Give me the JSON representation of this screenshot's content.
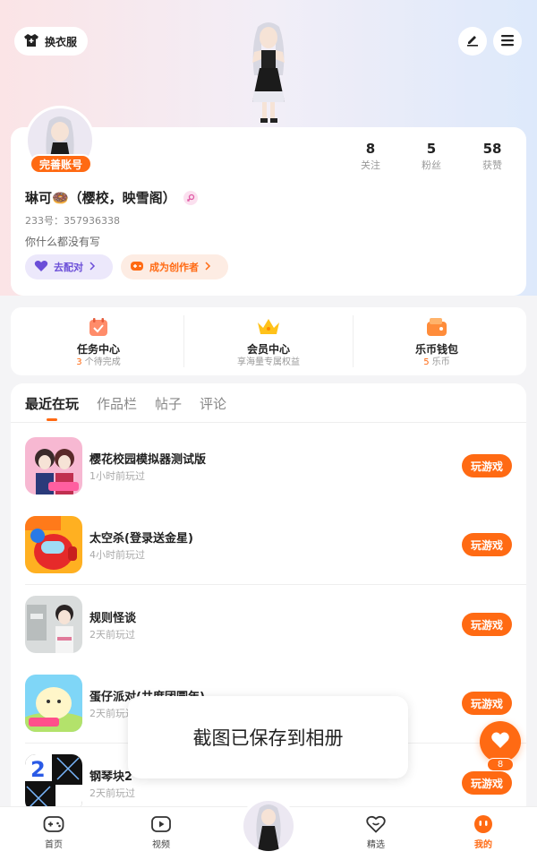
{
  "top": {
    "outfit_label": "换衣服"
  },
  "profile": {
    "badge": "完善账号",
    "stats": [
      {
        "value": "8",
        "label": "关注"
      },
      {
        "value": "5",
        "label": "粉丝"
      },
      {
        "value": "58",
        "label": "获赞"
      }
    ],
    "name": "琳可🍩（樱校，映雪阁）",
    "uid": "233号：357936338",
    "bio": "你什么都没有写",
    "pair_label": "去配对",
    "creator_label": "成为创作者"
  },
  "quick": [
    {
      "title": "任务中心",
      "count": "3",
      "sub": "个待完成"
    },
    {
      "title": "会员中心",
      "count": "",
      "sub": "享海量专属权益"
    },
    {
      "title": "乐币钱包",
      "count": "5",
      "sub": "乐币"
    }
  ],
  "tabs": [
    "最近在玩",
    "作品栏",
    "帖子",
    "评论"
  ],
  "games": [
    {
      "name": "樱花校园模拟器测试版",
      "time": "1小时前玩过",
      "button": "玩游戏"
    },
    {
      "name": "太空杀(登录送金星)",
      "time": "4小时前玩过",
      "button": "玩游戏"
    },
    {
      "name": "规则怪谈",
      "time": "2天前玩过",
      "button": "玩游戏"
    },
    {
      "name": "蛋仔派对(共度团圆年)",
      "time": "2天前玩过",
      "button": "玩游戏"
    },
    {
      "name": "钢琴块2",
      "time": "2天前玩过",
      "button": "玩游戏"
    }
  ],
  "toast": "截图已保存到相册",
  "float_count": "8",
  "nav": [
    {
      "label": "首页"
    },
    {
      "label": "视频"
    },
    {
      "label": "精选"
    },
    {
      "label": "我的"
    }
  ],
  "colors": {
    "accent": "#ff6a13",
    "pair": "#6b4ed8"
  }
}
